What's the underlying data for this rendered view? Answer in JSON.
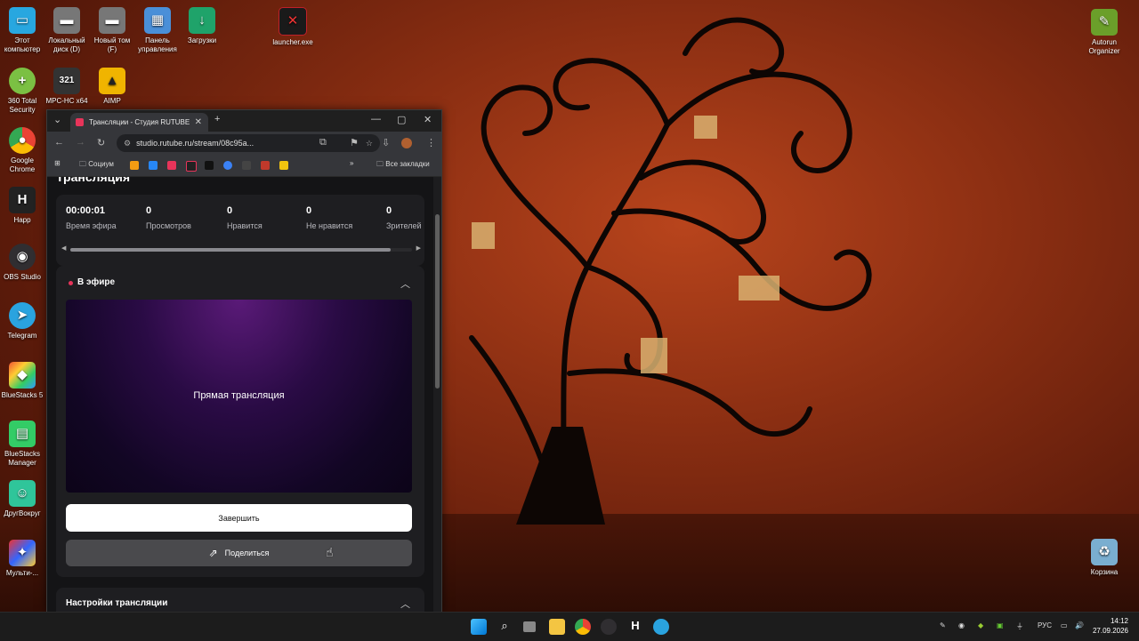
{
  "desktop": {
    "icons": [
      {
        "label": "Этот компьютер",
        "icon": "monitor-icon"
      },
      {
        "label": "Локальный диск (D)",
        "icon": "drive-icon"
      },
      {
        "label": "Новый том (F)",
        "icon": "drive-icon"
      },
      {
        "label": "Панель управления",
        "icon": "control-panel-icon"
      },
      {
        "label": "Загрузки",
        "icon": "downloads-icon"
      },
      {
        "label": "launcher.exe",
        "icon": "launcher-icon"
      },
      {
        "label": "360 Total Security",
        "icon": "360-icon"
      },
      {
        "label": "MPC-HC x64",
        "icon": "mpc-icon"
      },
      {
        "label": "AIMP",
        "icon": "aimp-icon"
      },
      {
        "label": "Google Chrome",
        "icon": "chrome-icon"
      },
      {
        "label": "Happ",
        "icon": "happ-icon"
      },
      {
        "label": "OBS Studio",
        "icon": "obs-icon"
      },
      {
        "label": "Telegram",
        "icon": "telegram-icon"
      },
      {
        "label": "BlueStacks 5",
        "icon": "bluestacks-icon"
      },
      {
        "label": "BlueStacks Manager",
        "icon": "bluestacks-manager-icon"
      },
      {
        "label": "ДругВокруг",
        "icon": "drugvokrug-icon"
      },
      {
        "label": "Мульти-...",
        "icon": "multi-icon"
      },
      {
        "label": "Autorun Organizer",
        "icon": "autorun-icon"
      },
      {
        "label": "Корзина",
        "icon": "recycle-bin-icon"
      }
    ]
  },
  "browser": {
    "tab_title": "Трансляции - Студия RUTUBE",
    "url": "studio.rutube.ru/stream/08c95a...",
    "bookmarks": {
      "folder": "Социум",
      "all": "Все закладки"
    }
  },
  "page": {
    "heading": "Трансляция",
    "stats": [
      {
        "value": "00:00:01",
        "label": "Время эфира"
      },
      {
        "value": "0",
        "label": "Просмотров"
      },
      {
        "value": "0",
        "label": "Нравится"
      },
      {
        "value": "0",
        "label": "Не нравится"
      },
      {
        "value": "0",
        "label": "Зрителей"
      }
    ],
    "live_label": "В эфире",
    "player_text": "Прямая трансляция",
    "end_button": "Завершить",
    "share_button": "Поделиться",
    "settings_title": "Настройки трансляции"
  },
  "taskbar": {
    "lang": "РУС",
    "time": "14:12",
    "date": "27.09.2026"
  },
  "colors": {
    "accent": "#e7345a",
    "player": "#2a0b45"
  }
}
